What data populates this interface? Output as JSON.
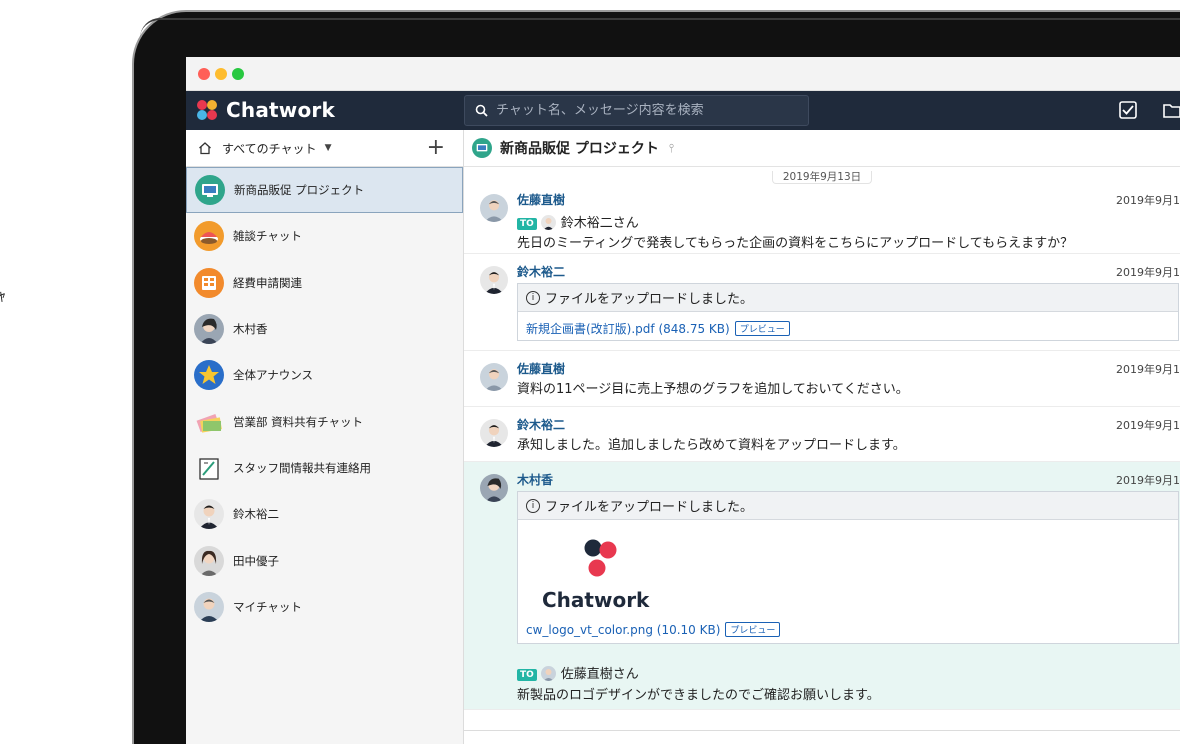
{
  "left_fragment": "ｬ",
  "app": {
    "name": "Chatwork"
  },
  "search": {
    "placeholder": "チャット名、メッセージ内容を検索"
  },
  "sidebar": {
    "filter_label": "すべてのチャット",
    "add_label": "+",
    "rooms": [
      {
        "name": "新商品販促 プロジェクト",
        "selected": true
      },
      {
        "name": "雑談チャット"
      },
      {
        "name": "経費申請関連"
      },
      {
        "name": "木村香"
      },
      {
        "name": "全体アナウンス"
      },
      {
        "name": "営業部 資料共有チャット"
      },
      {
        "name": "スタッフ間情報共有連絡用"
      },
      {
        "name": "鈴木裕二"
      },
      {
        "name": "田中優子"
      },
      {
        "name": "マイチャット"
      }
    ]
  },
  "room": {
    "title": "新商品販促 プロジェクト",
    "date_separator": "2019年9月13日",
    "messages": [
      {
        "author": "佐藤直樹",
        "time": "2019年9月1",
        "to": "TO",
        "to_name": "鈴木裕二さん",
        "text": "先日のミーティングで発表してもらった企画の資料をこちらにアップロードしてもらえますか？"
      },
      {
        "author": "鈴木裕二",
        "time": "2019年9月1",
        "file_notice": "ファイルをアップロードしました。",
        "file_name": "新規企画書(改訂版).pdf (848.75 KB)",
        "preview": "プレビュー"
      },
      {
        "author": "佐藤直樹",
        "time": "2019年9月1",
        "text": "資料の11ページ目に売上予想のグラフを追加しておいてください。"
      },
      {
        "author": "鈴木裕二",
        "time": "2019年9月1",
        "text": "承知しました。追加しましたら改めて資料をアップロードします。"
      },
      {
        "author": "木村香",
        "time": "2019年9月1",
        "file_notice": "ファイルをアップロードしました。",
        "image_logo_text": "Chatwork",
        "file_name": "cw_logo_vt_color.png (10.10 KB)",
        "preview": "プレビュー",
        "to": "TO",
        "to_name": "佐藤直樹さん",
        "text": "新製品のロゴデザインができましたのでご確認お願いします。"
      }
    ]
  },
  "colors": {
    "appbar": "#1f2a3b",
    "link": "#1a61b5",
    "author": "#1d5a8c",
    "highlight": "#e8f6f3",
    "to_badge": "#22b5a5"
  }
}
